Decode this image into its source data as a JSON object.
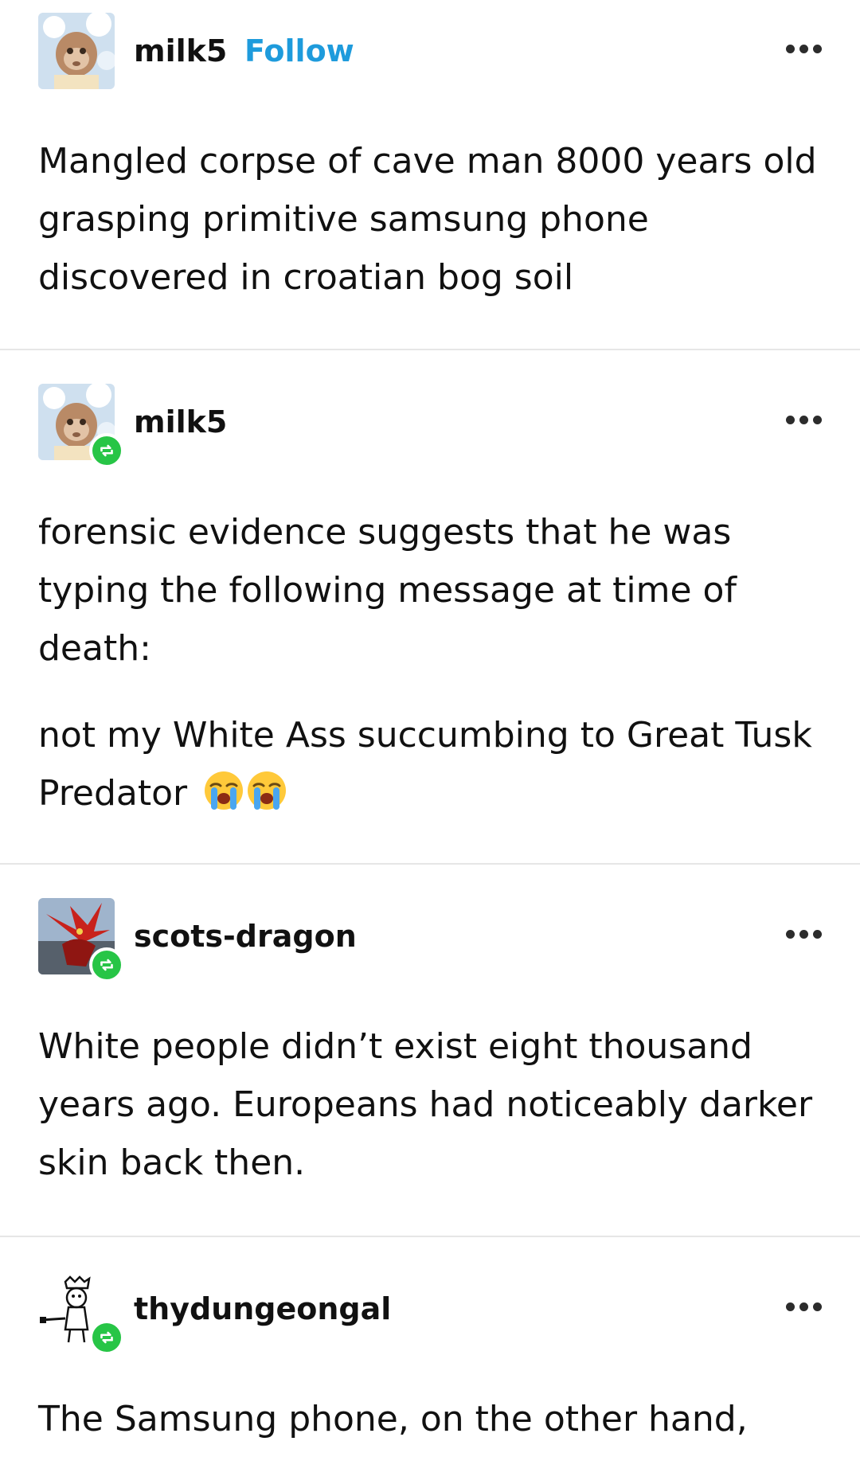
{
  "posts": [
    {
      "username": "milk5",
      "follow_label": "Follow",
      "reblogged": false,
      "paragraphs": [
        "Mangled corpse of cave man 8000 years old grasping primitive samsung phone discovered in croatian bog soil"
      ]
    },
    {
      "username": "milk5",
      "reblogged": true,
      "paragraphs": [
        "forensic evidence suggests that he was typing the following message at time of death:",
        "not my White Ass succumbing to Great Tusk Predator"
      ],
      "emoji": [
        "loudly-crying-face",
        "loudly-crying-face"
      ]
    },
    {
      "username": "scots-dragon",
      "reblogged": true,
      "paragraphs": [
        "White people didn’t exist eight thousand years ago. Europeans had noticeably darker skin back then."
      ]
    },
    {
      "username": "thydungeongal",
      "reblogged": true,
      "paragraphs": [
        "The Samsung phone, on the other hand,"
      ]
    }
  ],
  "icons": {
    "more": "ellipsis-icon",
    "reblog": "reblog-icon"
  },
  "colors": {
    "follow": "#1e9bdc",
    "reblog_badge": "#27c546",
    "divider": "#e6e6e6"
  }
}
